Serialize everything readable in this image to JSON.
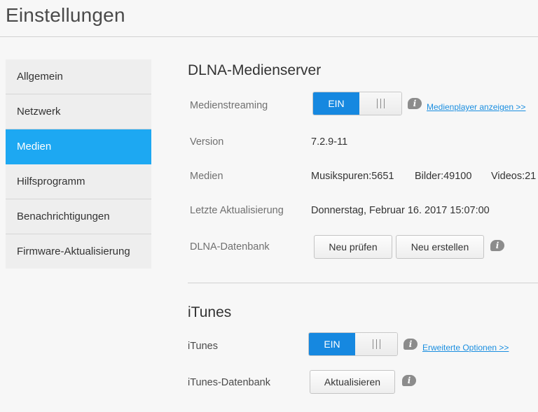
{
  "page_title": "Einstellungen",
  "sidebar": {
    "items": [
      {
        "label": "Allgemein"
      },
      {
        "label": "Netzwerk"
      },
      {
        "label": "Medien"
      },
      {
        "label": "Hilfsprogramm"
      },
      {
        "label": "Benachrichtigungen"
      },
      {
        "label": "Firmware-Aktualisierung"
      }
    ],
    "active_index": 2
  },
  "dlna": {
    "title": "DLNA-Medienserver",
    "streaming_label": "Medienstreaming",
    "toggle_on_label": "EIN",
    "player_link": "Medienplayer anzeigen >>",
    "version_label": "Version",
    "version_value": "7.2.9-11",
    "media_label": "Medien",
    "music": "Musikspuren:5651",
    "pictures": "Bilder:49100",
    "videos": "Videos:21",
    "last_update_label": "Letzte Aktualisierung",
    "last_update_value": "Donnerstag, Februar 16. 2017 15:07:00",
    "database_label": "DLNA-Datenbank",
    "rescan_button": "Neu prüfen",
    "rebuild_button": "Neu erstellen"
  },
  "itunes": {
    "title": "iTunes",
    "itunes_label": "iTunes",
    "toggle_on_label": "EIN",
    "advanced_link": "Erweiterte Optionen >>",
    "database_label": "iTunes-Datenbank",
    "refresh_button": "Aktualisieren"
  },
  "colors": {
    "accent": "#1da8f2",
    "toggle_on": "#1688e0",
    "link": "#1a8ee0"
  }
}
